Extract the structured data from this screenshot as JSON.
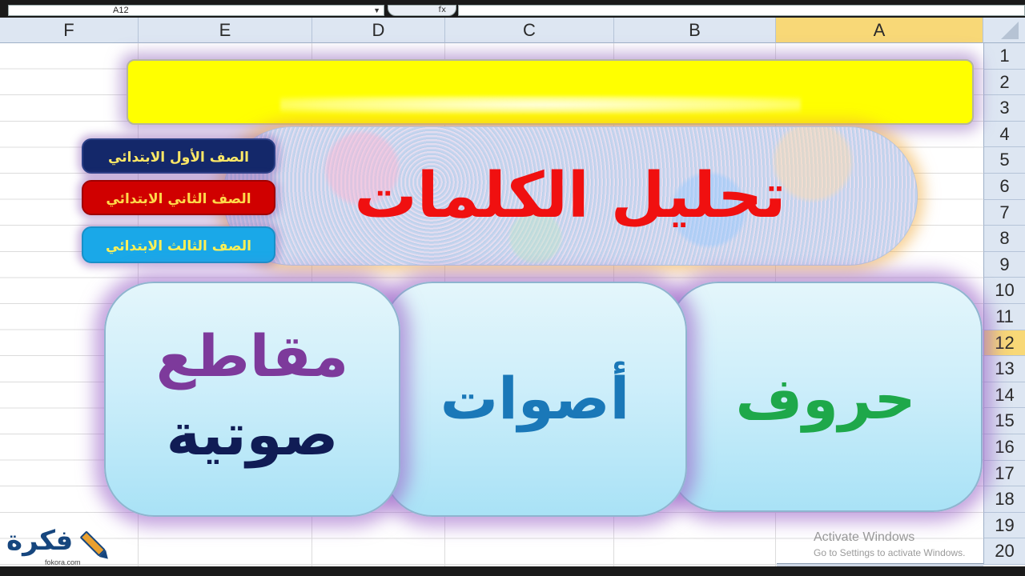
{
  "formula_bar": {
    "name_box": "A12",
    "fx_label": "fx"
  },
  "columns": [
    {
      "label": "F",
      "selected": false
    },
    {
      "label": "E",
      "selected": false
    },
    {
      "label": "D",
      "selected": false
    },
    {
      "label": "C",
      "selected": false
    },
    {
      "label": "B",
      "selected": false
    },
    {
      "label": "A",
      "selected": true
    }
  ],
  "rows": [
    "1",
    "2",
    "3",
    "4",
    "5",
    "6",
    "7",
    "8",
    "9",
    "10",
    "11",
    "12",
    "13",
    "14",
    "15",
    "16",
    "17",
    "18",
    "19",
    "20"
  ],
  "selected_row": "12",
  "banner": {
    "color": "#ffff00"
  },
  "title": {
    "text": "تحليل الكلمات",
    "color": "#f01010"
  },
  "grade_buttons": [
    {
      "label": "الصف الأول الابتدائي",
      "color": "#14286a"
    },
    {
      "label": "الصف الثاني الابتدائي",
      "color": "#d00000"
    },
    {
      "label": "الصف الثالث الابتدائي",
      "color": "#1aa8e8"
    }
  ],
  "cards": [
    {
      "lines": [
        "حروف"
      ],
      "color": "#1ea84a"
    },
    {
      "lines": [
        "أصوات"
      ],
      "color": "#1a78b8"
    },
    {
      "lines": [
        "مقاطع",
        "صوتية"
      ],
      "colors": [
        "#7d3a9b",
        "#101c55"
      ]
    }
  ],
  "watermark": {
    "title": "Activate Windows",
    "subtitle": "Go to Settings to activate Windows."
  },
  "logo": {
    "text": "فكرة",
    "url_text": "fokora.com",
    "icon": "pencil-icon"
  }
}
